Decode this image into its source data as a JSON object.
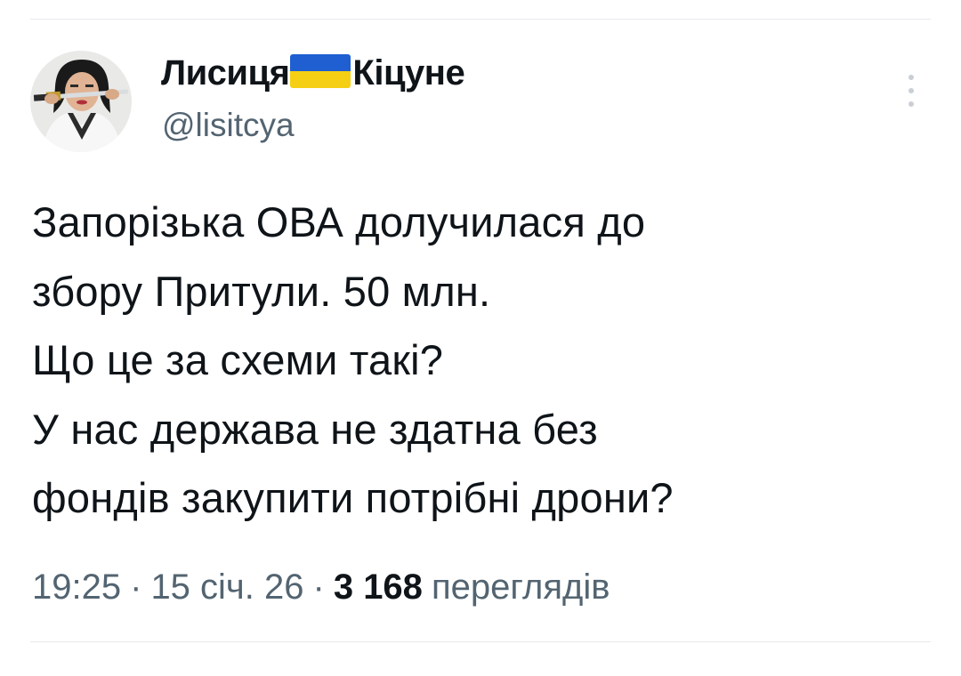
{
  "author": {
    "name_left": "Лисиця",
    "name_right": "Кіцуне",
    "flag_icon": "ukraine-flag",
    "flag_colors": [
      "#1f5fd1",
      "#f5cf14"
    ],
    "handle": "@lisitcya"
  },
  "tweet": {
    "lines": [
      "Запорізька ОВА долучилася до",
      "збору Притули. 50 млн.",
      "Що це за схеми такі?",
      "У нас держава не здатна без",
      "фондів закупити потрібні дрони?"
    ]
  },
  "meta": {
    "time": "19:25",
    "separator": "·",
    "date": "15 січ. 26",
    "views_count": "3 168",
    "views_label": "переглядів"
  },
  "menu": {
    "icon": "more-vertical-icon"
  },
  "colors": {
    "text_primary": "#0f1419",
    "text_secondary": "#536471",
    "divider": "#e6e9eb"
  }
}
